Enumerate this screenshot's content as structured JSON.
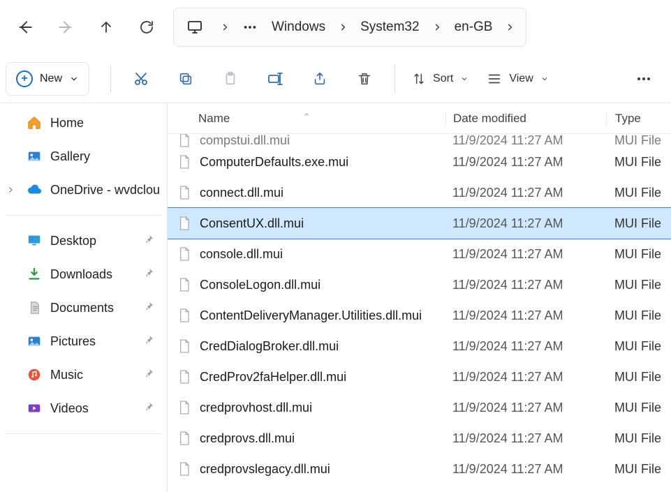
{
  "breadcrumb": {
    "segments": [
      "Windows",
      "System32",
      "en-GB"
    ]
  },
  "toolbar": {
    "new_label": "New",
    "sort_label": "Sort",
    "view_label": "View"
  },
  "sidebar": {
    "home": "Home",
    "gallery": "Gallery",
    "onedrive": "OneDrive - wvdclou",
    "quick": [
      {
        "label": "Desktop"
      },
      {
        "label": "Downloads"
      },
      {
        "label": "Documents"
      },
      {
        "label": "Pictures"
      },
      {
        "label": "Music"
      },
      {
        "label": "Videos"
      }
    ]
  },
  "columns": {
    "name": "Name",
    "date": "Date modified",
    "type": "Type"
  },
  "files": [
    {
      "name": "compstui.dll.mui",
      "date": "11/9/2024 11:27 AM",
      "type": "MUI File",
      "partial_top": true
    },
    {
      "name": "ComputerDefaults.exe.mui",
      "date": "11/9/2024 11:27 AM",
      "type": "MUI File"
    },
    {
      "name": "connect.dll.mui",
      "date": "11/9/2024 11:27 AM",
      "type": "MUI File"
    },
    {
      "name": "ConsentUX.dll.mui",
      "date": "11/9/2024 11:27 AM",
      "type": "MUI File",
      "selected": true
    },
    {
      "name": "console.dll.mui",
      "date": "11/9/2024 11:27 AM",
      "type": "MUI File"
    },
    {
      "name": "ConsoleLogon.dll.mui",
      "date": "11/9/2024 11:27 AM",
      "type": "MUI File"
    },
    {
      "name": "ContentDeliveryManager.Utilities.dll.mui",
      "date": "11/9/2024 11:27 AM",
      "type": "MUI File"
    },
    {
      "name": "CredDialogBroker.dll.mui",
      "date": "11/9/2024 11:27 AM",
      "type": "MUI File"
    },
    {
      "name": "CredProv2faHelper.dll.mui",
      "date": "11/9/2024 11:27 AM",
      "type": "MUI File"
    },
    {
      "name": "credprovhost.dll.mui",
      "date": "11/9/2024 11:27 AM",
      "type": "MUI File"
    },
    {
      "name": "credprovs.dll.mui",
      "date": "11/9/2024 11:27 AM",
      "type": "MUI File"
    },
    {
      "name": "credprovslegacy.dll.mui",
      "date": "11/9/2024 11:27 AM",
      "type": "MUI File"
    }
  ]
}
